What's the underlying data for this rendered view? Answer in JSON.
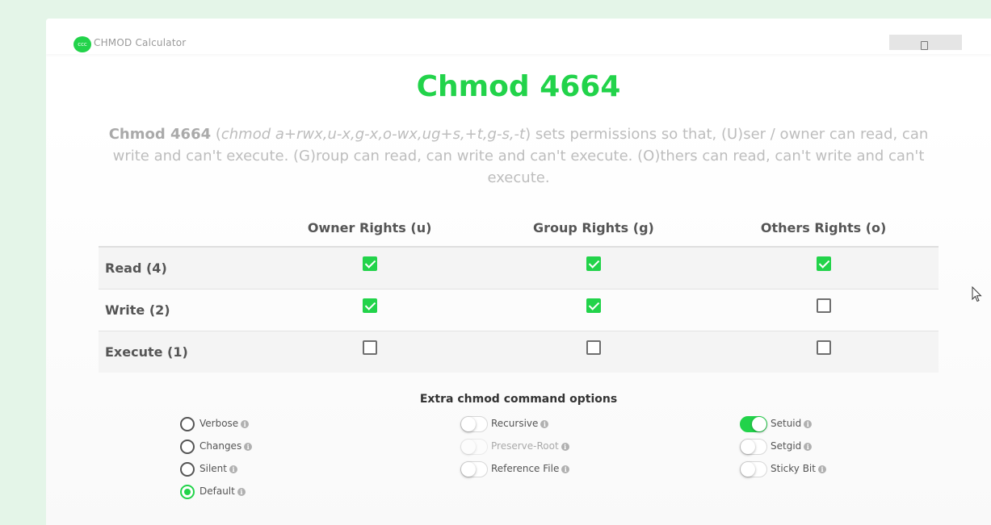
{
  "brand": {
    "logo_text": "ccc",
    "name": "CHMOD Calculator"
  },
  "title": "Chmod 4664",
  "description": {
    "lead": "Chmod 4664",
    "command": "chmod a+rwx,u-x,g-x,o-wx,ug+s,+t,g-s,-t",
    "text": "sets permissions so that, (U)ser / owner can read, can write and can't execute. (G)roup can read, can write and can't execute. (O)thers can read, can't write and can't execute."
  },
  "permissions": {
    "headers": [
      "",
      "Owner Rights (u)",
      "Group Rights (g)",
      "Others Rights (o)"
    ],
    "rows": [
      {
        "label": "Read (4)",
        "values": [
          true,
          true,
          true
        ]
      },
      {
        "label": "Write (2)",
        "values": [
          true,
          true,
          false
        ]
      },
      {
        "label": "Execute (1)",
        "values": [
          false,
          false,
          false
        ]
      }
    ]
  },
  "options": {
    "title": "Extra chmod command options",
    "radios": [
      {
        "label": "Verbose",
        "selected": false
      },
      {
        "label": "Changes",
        "selected": false
      },
      {
        "label": "Silent",
        "selected": false
      },
      {
        "label": "Default",
        "selected": true
      }
    ],
    "toggles_mid": [
      {
        "label": "Recursive",
        "on": false,
        "disabled": false
      },
      {
        "label": "Preserve-Root",
        "on": false,
        "disabled": true
      },
      {
        "label": "Reference File",
        "on": false,
        "disabled": false
      }
    ],
    "toggles_right": [
      {
        "label": "Setuid",
        "on": true,
        "disabled": false
      },
      {
        "label": "Setgid",
        "on": false,
        "disabled": false
      },
      {
        "label": "Sticky Bit",
        "on": false,
        "disabled": false
      }
    ],
    "info_glyph": "i"
  },
  "colors": {
    "accent": "#22d34a",
    "background": "#e4f5e8"
  }
}
